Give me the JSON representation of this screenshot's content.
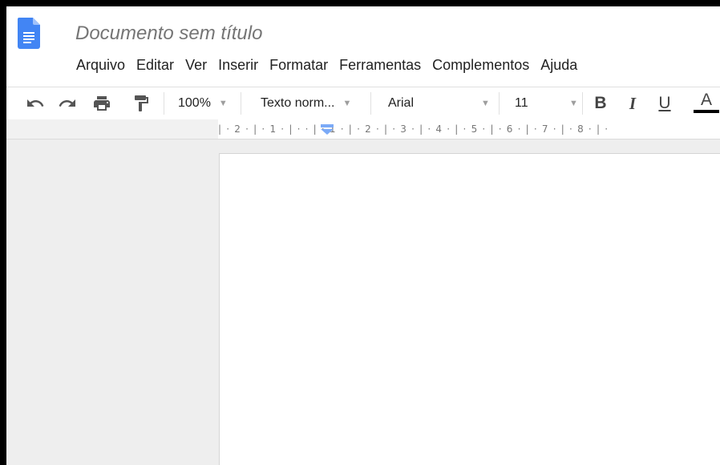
{
  "app": {
    "document_title": "Documento sem título"
  },
  "menu": {
    "items": [
      "Arquivo",
      "Editar",
      "Ver",
      "Inserir",
      "Formatar",
      "Ferramentas",
      "Complementos",
      "Ajuda"
    ]
  },
  "toolbar": {
    "zoom": "100%",
    "style": "Texto norm...",
    "font": "Arial",
    "font_size": "11",
    "bold_label": "B",
    "italic_label": "I",
    "underline_label": "U",
    "text_color_label": "A",
    "icons": [
      "undo-icon",
      "redo-icon",
      "print-icon",
      "paint-format-icon"
    ]
  },
  "ruler": {
    "text": "| · 2 · | · 1 · | ·   · | · 1 · | · 2 · | · 3 · | · 4 · | · 5 · | · 6 · | · 7 · | · 8 · | ·"
  },
  "colors": {
    "doc_icon_blue": "#4285f4",
    "indent_marker": "#7baaf7",
    "text_color_bar": "#000000"
  }
}
